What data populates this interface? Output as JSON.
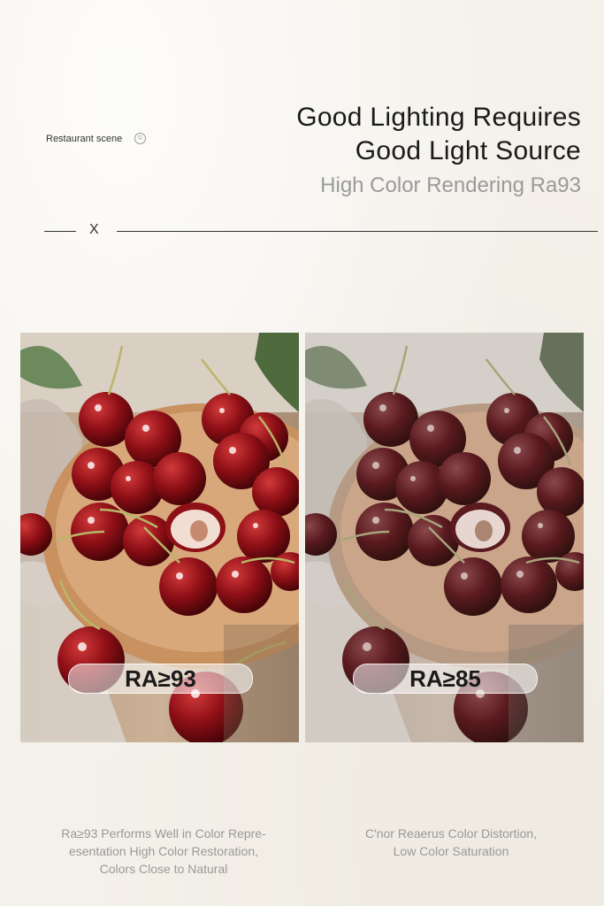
{
  "header": {
    "scene_label": "Restaurant scene",
    "scene_icon": "copyright-circle-icon",
    "headline_line1": "Good Lighting Requires",
    "headline_line2": "Good Light Source",
    "headline_line3": "High Color Rendering Ra93"
  },
  "divider": {
    "marker": "X"
  },
  "comparison": {
    "left": {
      "badge": "RA≥93",
      "caption_lines": [
        "Ra≥93 Performs Well in Color Repre-",
        "esentation High Color Restoration,",
        "Colors Close to Natural"
      ]
    },
    "right": {
      "badge": "RA≥85",
      "caption_lines": [
        "C'nor Reaerus Color Distortion,",
        "Low Color Saturation"
      ]
    }
  },
  "colors": {
    "cherry_vivid": "#8e0f16",
    "cherry_dull": "#5a1a1f",
    "plate_vivid": "#d8a77a",
    "plate_dull": "#caa58a",
    "background": "#f4f1ea"
  }
}
